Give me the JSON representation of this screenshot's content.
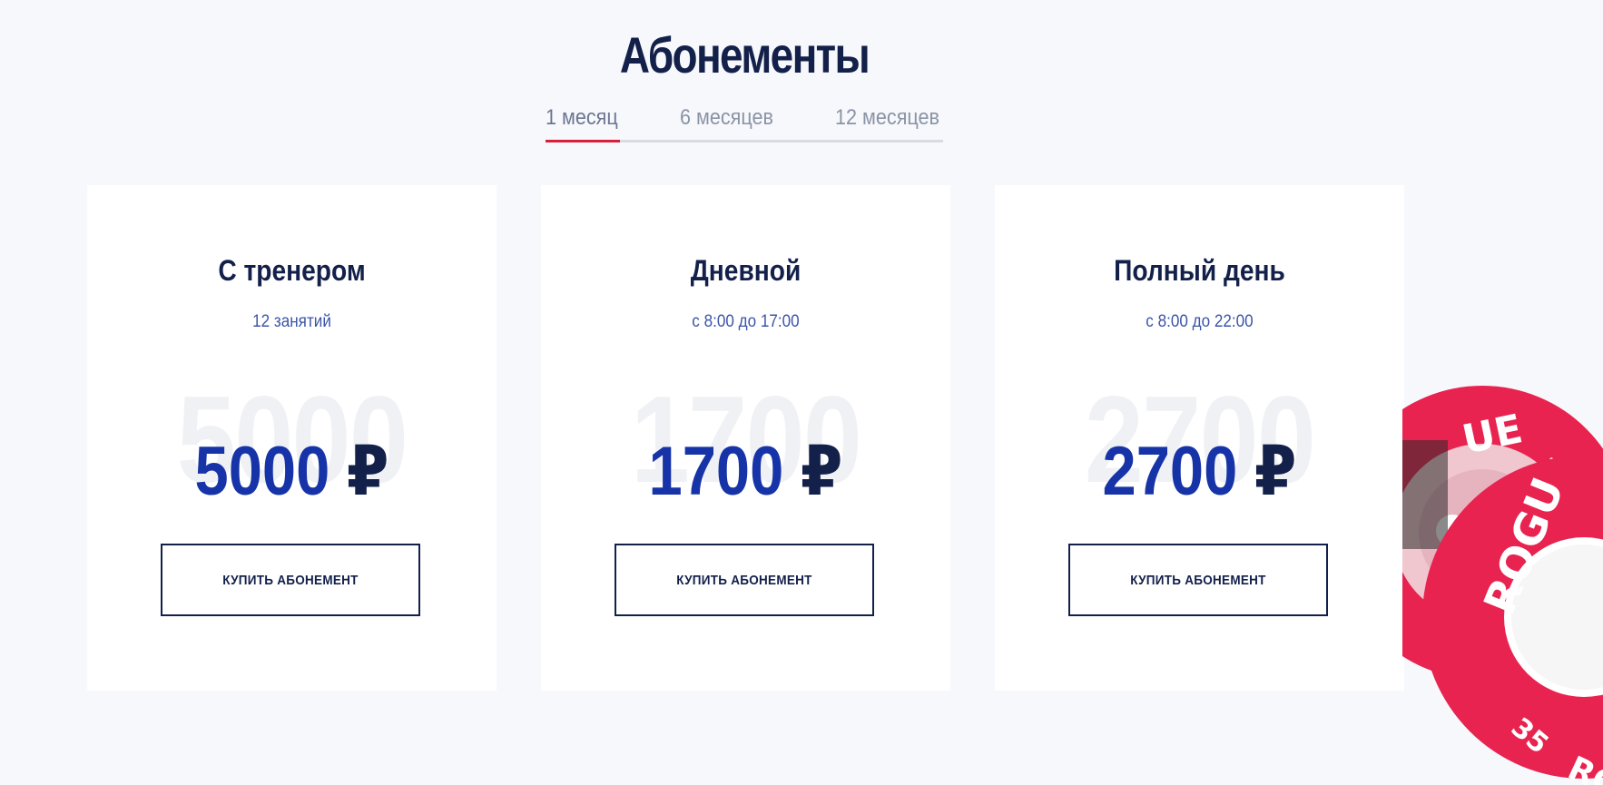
{
  "section": {
    "title": "Абонементы"
  },
  "tabs": [
    {
      "label": "1 месяц",
      "active": true
    },
    {
      "label": "6 месяцев",
      "active": false
    },
    {
      "label": "12 месяцев",
      "active": false
    }
  ],
  "cards": [
    {
      "title": "С тренером",
      "subtitle": "12 занятий",
      "price": "5000",
      "currency": "₽",
      "button": "КУПИТЬ АБОНЕМЕНТ"
    },
    {
      "title": "Дневной",
      "subtitle": "с 8:00 до 17:00",
      "price": "1700",
      "currency": "₽",
      "button": "КУПИТЬ АБОНЕМЕНТ"
    },
    {
      "title": "Полный день",
      "subtitle": "с 8:00 до 22:00",
      "price": "2700",
      "currency": "₽",
      "button": "КУПИТЬ АБОНЕМЕНТ"
    }
  ],
  "decoration": {
    "plate_brand": "ROGUE",
    "plate_weight": "35",
    "plate_color": "#e8234f"
  },
  "colors": {
    "accent": "#d81f3c",
    "price": "#1634a8",
    "navy": "#13204a"
  }
}
